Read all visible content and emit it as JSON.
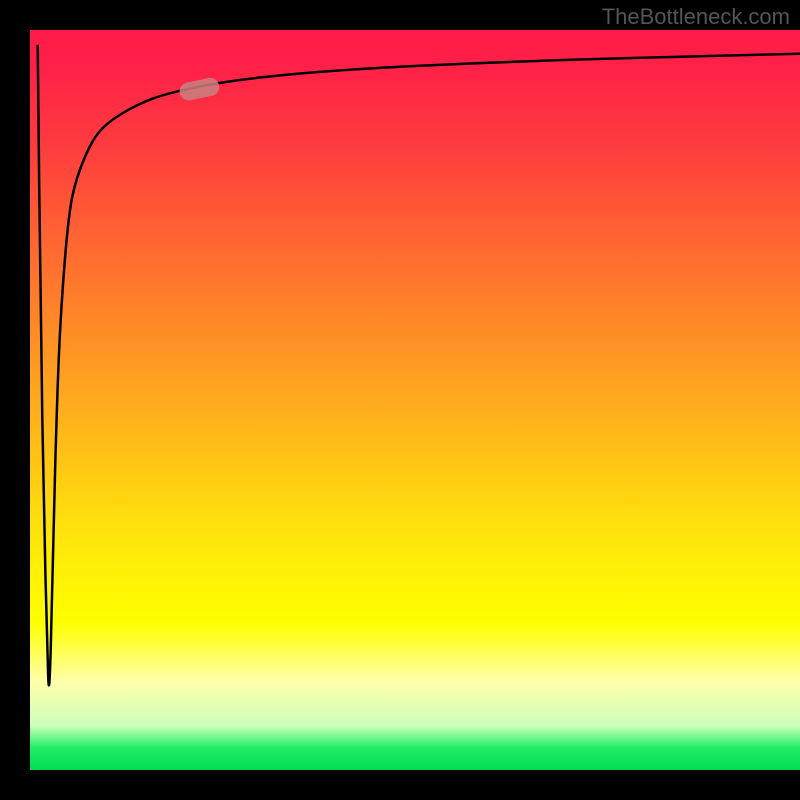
{
  "attribution": "TheBottleneck.com",
  "chart_data": {
    "type": "line",
    "title": "",
    "xlabel": "",
    "ylabel": "",
    "xlim": [
      0,
      100
    ],
    "ylim": [
      0,
      100
    ],
    "grid": false,
    "background_gradient": {
      "direction": "vertical",
      "stops": [
        {
          "pos": 0,
          "color": "#ff1a4a"
        },
        {
          "pos": 50,
          "color": "#ffba18"
        },
        {
          "pos": 80,
          "color": "#ffff00"
        },
        {
          "pos": 100,
          "color": "#00dd55"
        }
      ]
    },
    "series": [
      {
        "name": "bottleneck-curve",
        "x": [
          1.0,
          1.4,
          1.8,
          2.2,
          2.5,
          3.0,
          3.5,
          4.0,
          5.0,
          6.0,
          8.0,
          10.0,
          14.0,
          18.0,
          25.0,
          35.0,
          50.0,
          70.0,
          100.0
        ],
        "y": [
          98,
          60,
          35,
          18,
          8,
          30,
          50,
          62,
          75,
          80,
          85,
          87.5,
          90,
          91.5,
          93,
          94.2,
          95.2,
          96,
          96.8
        ]
      }
    ],
    "marker": {
      "x": 22,
      "y": 92,
      "color": "#c98080",
      "shape": "pill"
    }
  }
}
